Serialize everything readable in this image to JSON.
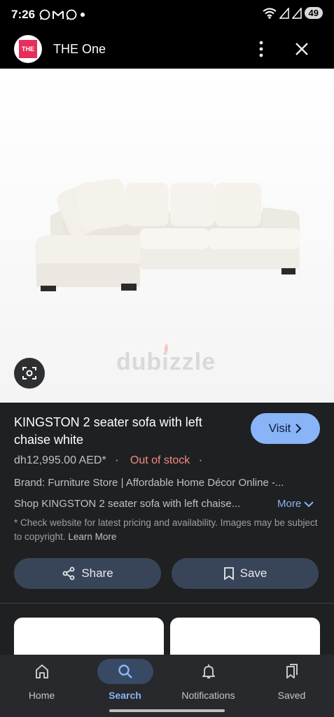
{
  "status_bar": {
    "time": "7:26",
    "battery": "49"
  },
  "header": {
    "title": "THE One",
    "logo_text": "THE"
  },
  "image": {
    "watermark": "dubizzle"
  },
  "product": {
    "title": "KINGSTON 2 seater sofa with left chaise white",
    "visit_label": "Visit",
    "price": "dh12,995.00 AED*",
    "stock": "Out of stock",
    "dot": "·",
    "brand_line": "Brand: Furniture Store | Affordable Home Décor Online -...",
    "description": "Shop KINGSTON 2 seater sofa with left chaise...",
    "more_label": "More",
    "note": "* Check website for latest pricing and availability. Images may be subject to copyright.",
    "learn_more": "Learn More",
    "share_label": "Share",
    "save_label": "Save"
  },
  "bottom_nav": {
    "items": [
      {
        "label": "Home",
        "icon": "home-icon",
        "active": false
      },
      {
        "label": "Search",
        "icon": "search-icon",
        "active": true
      },
      {
        "label": "Notifications",
        "icon": "bell-icon",
        "active": false
      },
      {
        "label": "Saved",
        "icon": "bookmarks-icon",
        "active": false
      }
    ]
  },
  "colors": {
    "accent": "#8ab4f8",
    "out_of_stock": "#f28b82",
    "button_bg": "#384558",
    "brand_logo": "#e62e5b"
  }
}
